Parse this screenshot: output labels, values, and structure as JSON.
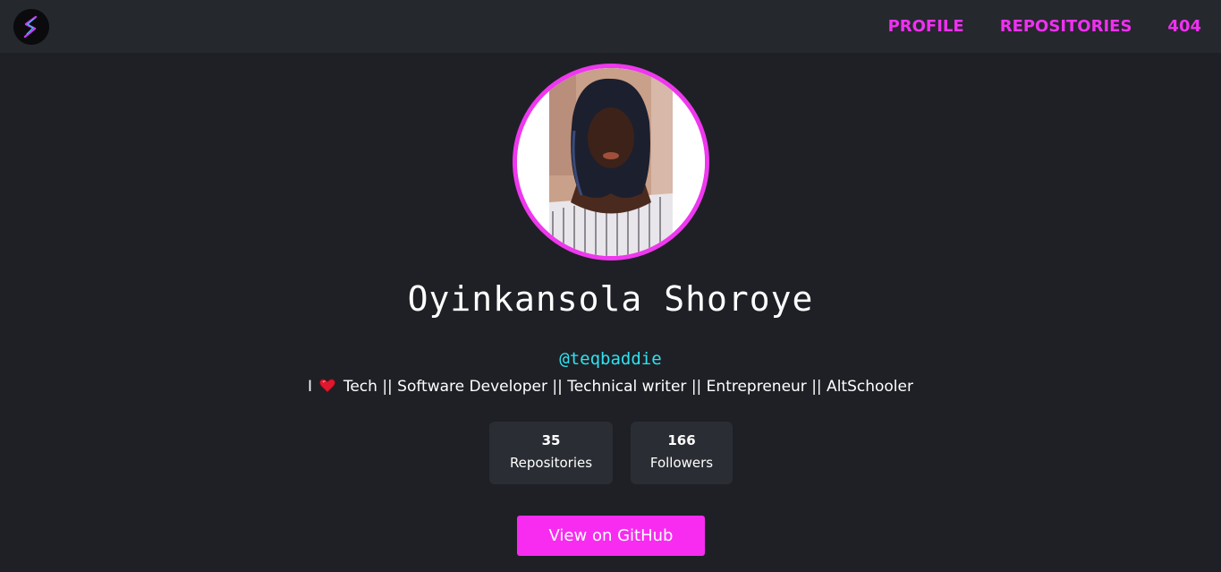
{
  "navbar": {
    "logo_icon": "lightning-s-logo",
    "links": [
      {
        "label": "PROFILE"
      },
      {
        "label": "REPOSITORIES"
      },
      {
        "label": "404"
      }
    ]
  },
  "profile": {
    "avatar": "profile-photo",
    "name": "Oyinkansola Shoroye",
    "handle": "@teqbaddie",
    "bio_before": "I",
    "bio_icon": "red-heart-icon",
    "bio_after": "Tech || Software Developer || Technical writer || Entrepreneur || AltSchooler"
  },
  "stats": {
    "repositories": {
      "value": "35",
      "label": "Repositories"
    },
    "followers": {
      "value": "166",
      "label": "Followers"
    }
  },
  "actions": {
    "github_button_label": "View on GitHub"
  },
  "colors": {
    "accent": "#f030f2",
    "handle": "#2fe2f0",
    "background": "#1e2025",
    "navbar": "#25282d",
    "card": "#2a2d33"
  }
}
